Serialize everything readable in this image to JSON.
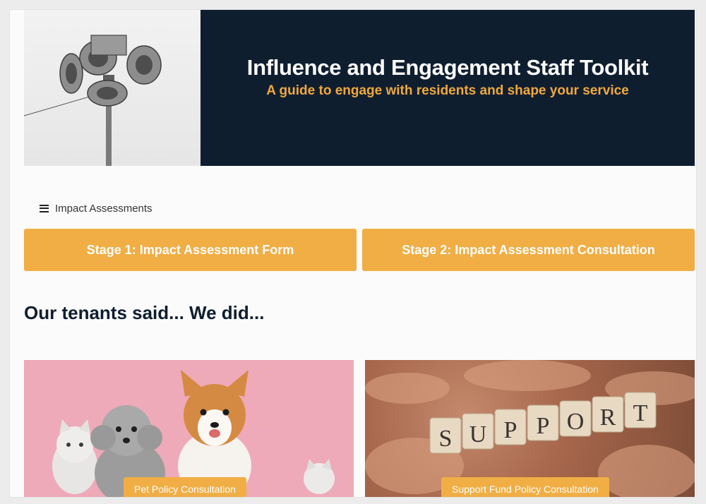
{
  "header": {
    "title": "Influence and Engagement Staff Toolkit",
    "subtitle": "A guide to engage with residents and shape your service",
    "image_icon": "megaphone-icon"
  },
  "nav": {
    "menu_label": "Impact Assessments",
    "menu_icon": "hamburger-icon"
  },
  "stages": [
    {
      "label": "Stage 1: Impact Assessment Form"
    },
    {
      "label": "Stage 2: Impact Assessment Consultation"
    }
  ],
  "section": {
    "heading": "Our tenants said... We did..."
  },
  "cards": [
    {
      "label": "Pet Policy Consultation",
      "image": "pets-photo"
    },
    {
      "label": "Support Fund Policy Consultation",
      "image": "support-blocks-photo",
      "blocks_text": "SUPPORT"
    }
  ],
  "colors": {
    "navy": "#0f1e2f",
    "accent": "#f0ae45",
    "subtitle_accent": "#f0a83e",
    "pet_card_bg": "#eeaab8"
  }
}
